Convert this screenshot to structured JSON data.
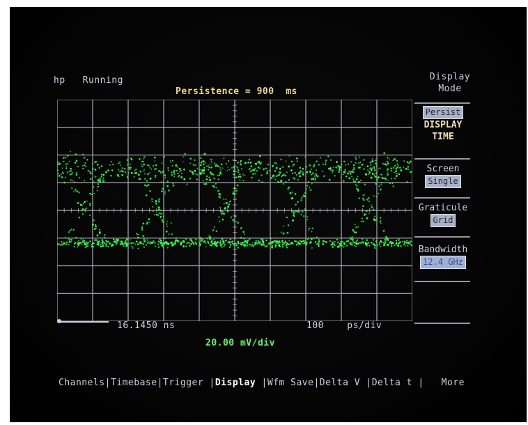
{
  "status": {
    "logo": "hp",
    "state": "Running"
  },
  "header": {
    "persistence_label": "Persistence =",
    "persistence_value": "900",
    "persistence_unit": "ms"
  },
  "panel": {
    "title_line1": "Display",
    "title_line2": "Mode",
    "mode_selected": "Persist",
    "display_time_line1": "DISPLAY",
    "display_time_line2": "TIME",
    "screen_label": "Screen",
    "screen_value": "Single",
    "graticule_label": "Graticule",
    "graticule_value": "Grid",
    "bandwidth_label": "Bandwidth",
    "bandwidth_value": "12.4 GHz"
  },
  "readouts": {
    "time_offset": "16.1450 ns",
    "timebase": "100",
    "timebase_unit": "ps/div",
    "vertical_scale": "20.00 mV/div"
  },
  "menu": {
    "items": [
      "Channels",
      "Timebase",
      "Trigger",
      "Display",
      "Wfm Save",
      "Delta V",
      "Delta t",
      "More"
    ],
    "active": "Display"
  },
  "colors": {
    "trace": "#3cff50",
    "text": "#cfcfe6",
    "grid": "#c8c8d8",
    "highlight": "#f0d890"
  }
}
